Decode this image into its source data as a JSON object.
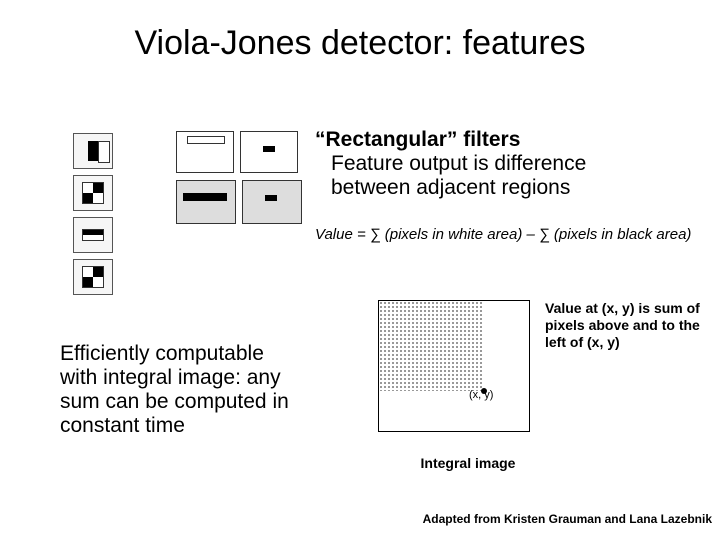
{
  "title": "Viola-Jones detector: features",
  "bullet1": {
    "head": "“Rectangular” filters",
    "line1": "Feature output is difference",
    "line2": "between adjacent regions"
  },
  "formula": "Value = ∑ (pixels in white area) – ∑ (pixels in black area)",
  "bullet2": {
    "line1": "Efficiently computable",
    "line2": "with integral image: any",
    "line3": "sum can be computed in",
    "line4": "constant time"
  },
  "integral": {
    "annot": "Value at (x, y) is sum of pixels above and to the left of (x, y)",
    "xy": "(x, y)",
    "caption": "Integral image"
  },
  "credit": "Adapted from Kristen Grauman and Lana Lazebnik"
}
